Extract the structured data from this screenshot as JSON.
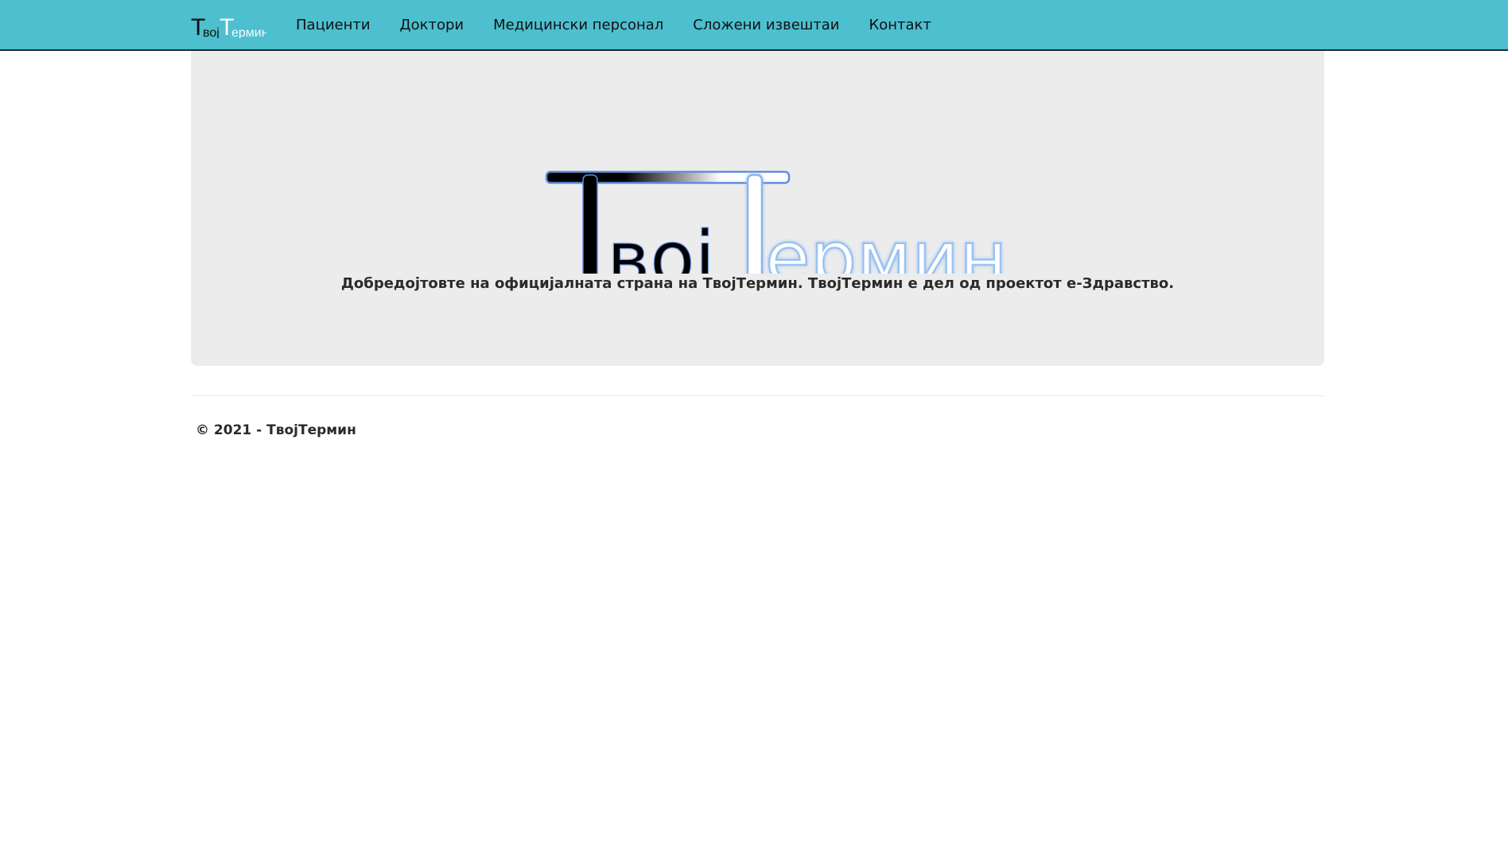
{
  "navbar": {
    "brand_logo_text": "ТвојТермин",
    "items": [
      {
        "label": "Пациенти"
      },
      {
        "label": "Доктори"
      },
      {
        "label": "Медицински персонал"
      },
      {
        "label": "Сложени извештаи"
      },
      {
        "label": "Контакт"
      }
    ]
  },
  "hero": {
    "logo_text": "ТвојТермин",
    "welcome_text": "Добредојтовте на официјалната страна на ТвојТермин. ТвојТермин е дел од проектот е-Здравство."
  },
  "footer": {
    "copyright": "© 2021 - ТвојТермин"
  },
  "colors": {
    "navbar_bg": "#4dbfcf",
    "jumbotron_bg": "#ececec"
  }
}
